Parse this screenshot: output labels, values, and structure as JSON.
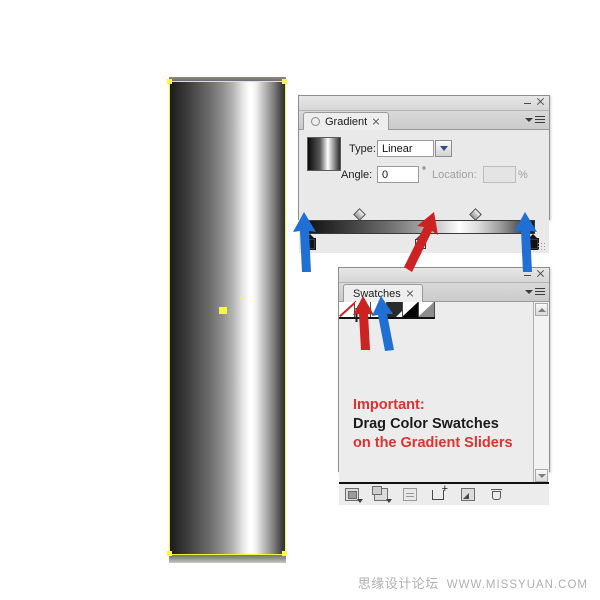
{
  "artwork": {
    "name": "gradient-cylinder-shape",
    "selection_color": "#f3f24a",
    "fill_gradient": "linear dark-to-light-to-dark metallic"
  },
  "gradient_panel": {
    "tab_label": "Gradient",
    "type_label": "Type:",
    "type_value": "Linear",
    "angle_label": "Angle:",
    "angle_value": "0",
    "degree_symbol": "°",
    "location_label": "Location:",
    "location_value": "",
    "percent_symbol": "%",
    "stops": [
      {
        "position_pct": 0,
        "color": "#111111",
        "selected": true
      },
      {
        "position_pct": 50,
        "color": "#ffffff",
        "selected": false
      },
      {
        "position_pct": 100,
        "color": "#111111",
        "selected": true
      }
    ],
    "midpoints_pct": [
      22,
      73
    ]
  },
  "swatches_panel": {
    "tab_label": "Swatches",
    "swatches": [
      {
        "name": "none",
        "label": "None"
      },
      {
        "name": "registration",
        "label": "Registration"
      },
      {
        "name": "white",
        "label": "White"
      },
      {
        "name": "dark",
        "label": "Dark Gray"
      },
      {
        "name": "black",
        "label": "Black"
      },
      {
        "name": "gray",
        "label": "50% Gray"
      }
    ],
    "note": {
      "line1": "Important:",
      "line2": "Drag Color Swatches",
      "line3": "on the Gradient Sliders",
      "line1_color": "#e03131",
      "line2_color": "#1b1b1b",
      "line3_color": "#e03131"
    },
    "footer_icons": [
      "swatch-group-icon",
      "color-group-icon",
      "show-options-icon",
      "new-color-group-icon",
      "new-swatch-icon",
      "delete-swatch-icon"
    ]
  },
  "annotations": {
    "arrow_blue_left": {
      "color": "#1f6fd4",
      "points_to": "left-gradient-stop"
    },
    "arrow_red_center": {
      "color": "#cc2222",
      "points_to": "center-gradient-stop"
    },
    "arrow_blue_right": {
      "color": "#1f6fd4",
      "points_to": "right-gradient-stop"
    },
    "arrow_red_swatch": {
      "color": "#cc2222",
      "points_to": "white-swatch"
    },
    "arrow_blue_swatch": {
      "color": "#1f6fd4",
      "points_to": "dark-swatch"
    }
  },
  "watermark": {
    "site_name": "思缘设计论坛",
    "url": "WWW.MISSYUAN.COM"
  }
}
